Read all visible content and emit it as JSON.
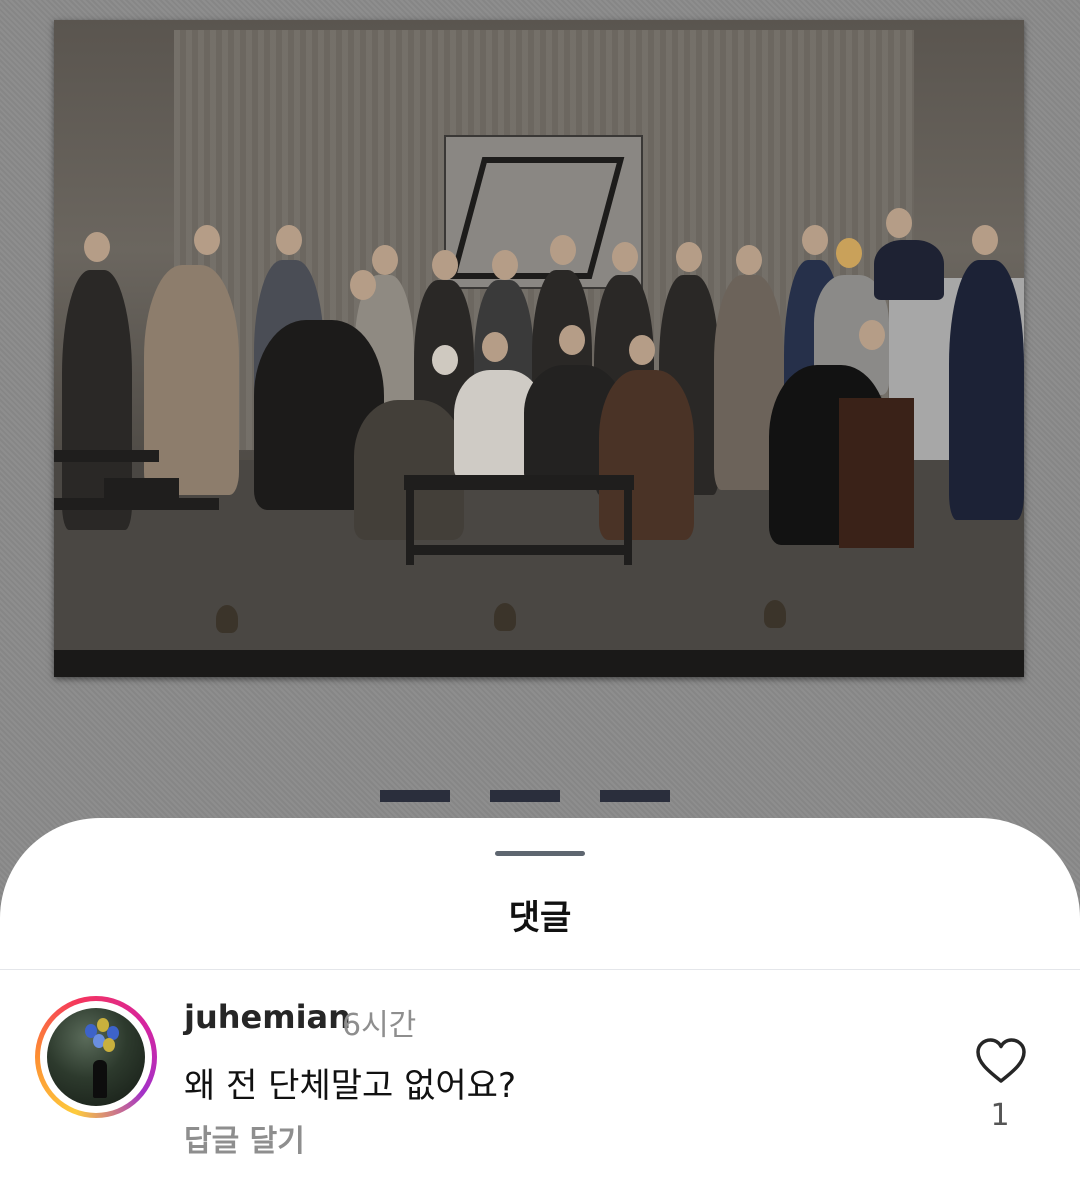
{
  "sheet": {
    "title": "댓글"
  },
  "comment": {
    "username": "juhemian",
    "time": "6시간",
    "text": "왜 전 단체말고 없어요?",
    "reply_label": "답글 달기",
    "like_count": "1",
    "like_icon": "heart-outline-icon"
  },
  "colors": {
    "sheet_bg": "#ffffff",
    "overlay": "#8a8a8a",
    "muted_text": "#8e8e8e",
    "story_ring": [
      "#fdcb3c",
      "#fd8d32",
      "#f4345e",
      "#d6249f",
      "#a332c8"
    ]
  }
}
